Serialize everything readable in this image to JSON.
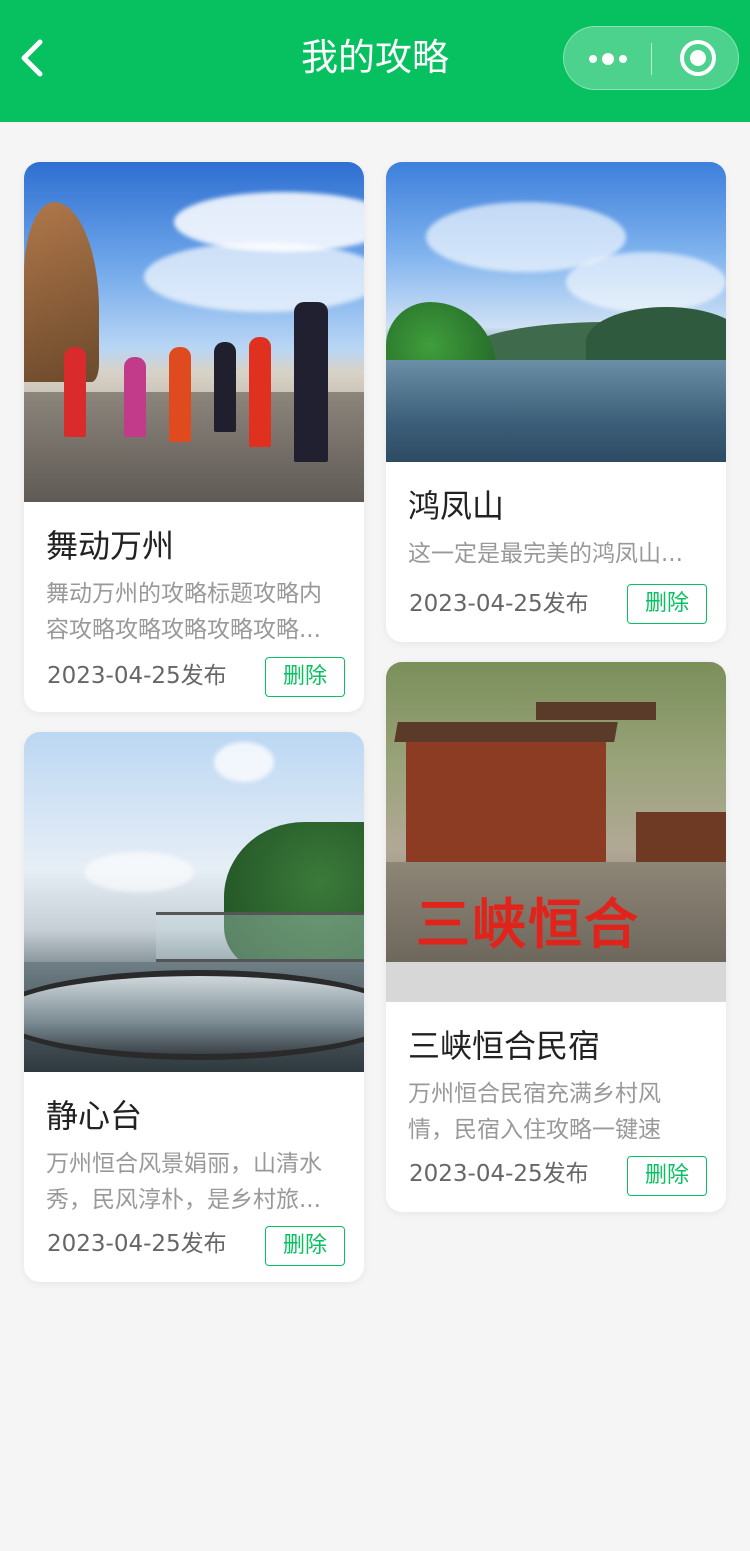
{
  "navbar": {
    "title": "我的攻略",
    "bg_color": "#07c160",
    "back_icon": "chevron-left-icon",
    "more_icon": "more-dots-icon",
    "close_icon": "target-circle-icon"
  },
  "cards": [
    {
      "title": "舞动万州",
      "desc": "舞动万州的攻略标题攻略内容攻略攻略攻略攻略攻略...",
      "date": "2023-04-25发布",
      "delete_label": "删除"
    },
    {
      "title": "鸿凤山",
      "desc": "这一定是最完美的鸿凤山...",
      "date": "2023-04-25发布",
      "delete_label": "删除"
    },
    {
      "title": "静心台",
      "desc": "万州恒合风景娟丽，山清水秀，民风淳朴，是乡村旅...",
      "date": "2023-04-25发布",
      "delete_label": "删除"
    },
    {
      "title": "三峡恒合民宿",
      "desc": "万州恒合民宿充满乡村风情，民宿入住攻略一键速",
      "date": "2023-04-25发布",
      "delete_label": "删除",
      "image_sign": "三峡恒合"
    }
  ],
  "accent_color": "#07c160"
}
